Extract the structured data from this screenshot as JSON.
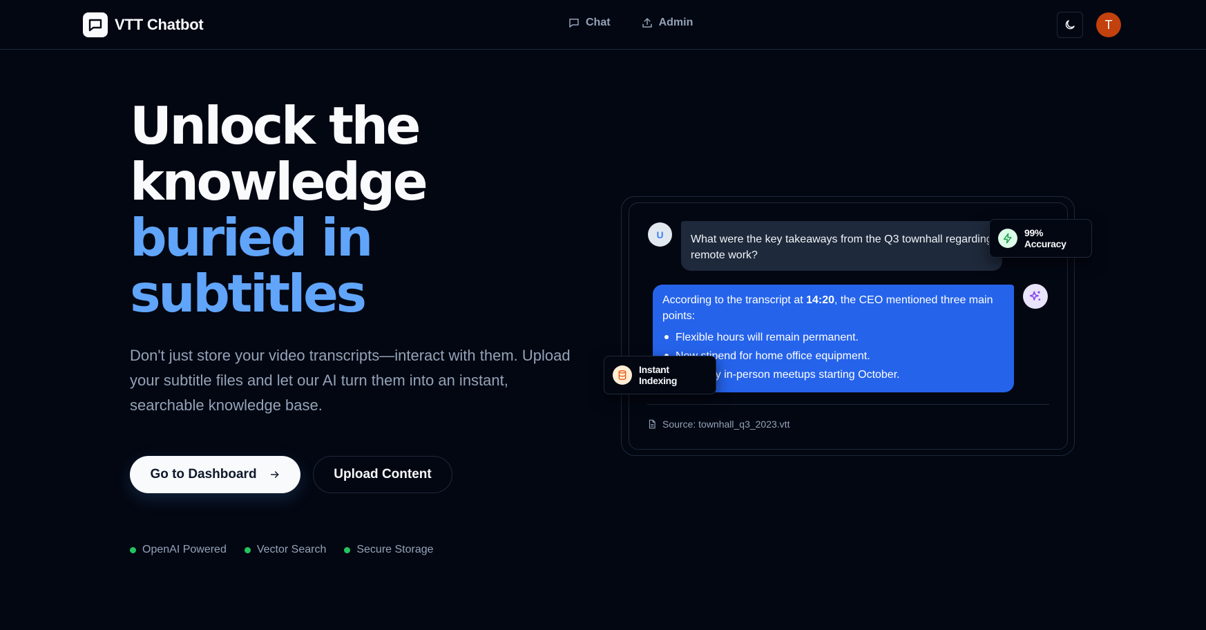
{
  "nav": {
    "brand": "VTT Chatbot",
    "links": [
      {
        "label": "Chat",
        "icon": "message-square-icon"
      },
      {
        "label": "Admin",
        "icon": "upload-icon"
      }
    ],
    "theme_toggle_icon": "moon-icon",
    "avatar_initial": "T"
  },
  "hero": {
    "title_lines": [
      "Unlock the",
      "knowledge",
      "buried in",
      "subtitles"
    ],
    "subtitle": "Don't just store your video transcripts—interact with them. Upload your subtitle files and let our AI turn them into an instant, searchable knowledge base.",
    "primary_button": "Go to Dashboard",
    "secondary_button": "Upload Content",
    "features": [
      "OpenAI Powered",
      "Vector Search",
      "Secure Storage"
    ]
  },
  "chat": {
    "user_initial": "U",
    "question": "What were the key takeaways from the Q3 townhall regarding remote work?",
    "answer_prefix": "According to the transcript at ",
    "answer_timestamp": "14:20",
    "answer_suffix": ", the CEO mentioned three main points:",
    "bullets": [
      "Flexible hours will remain permanent.",
      "New stipend for home office equipment.",
      "Quarterly in-person meetups starting October."
    ],
    "source": "Source: townhall_q3_2023.vtt"
  },
  "badges": {
    "accuracy": "99% Accuracy",
    "indexing": "Instant Indexing"
  },
  "colors": {
    "background": "#030712",
    "accent_blue": "#60a5fa",
    "ai_bubble": "#2563eb",
    "feature_dot": "#22c55e",
    "avatar": "#c2410c"
  }
}
